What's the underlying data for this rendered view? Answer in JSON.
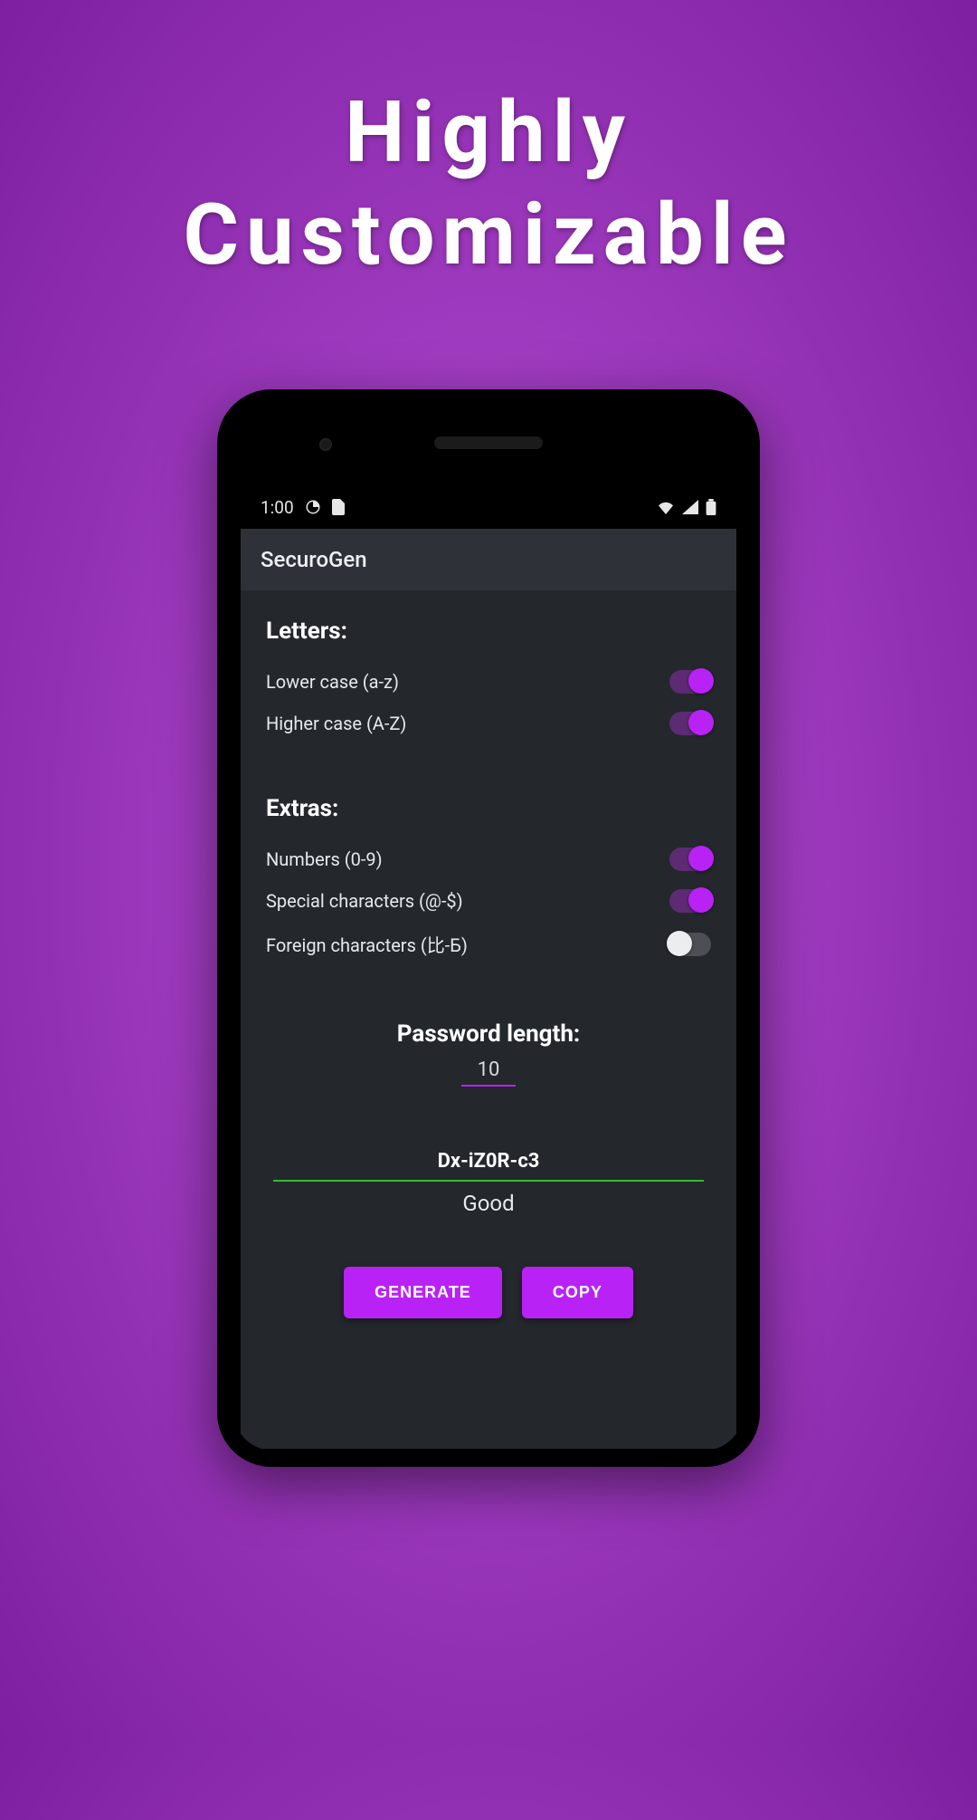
{
  "promo": {
    "line1": "Highly",
    "line2": "Customizable"
  },
  "statusbar": {
    "time": "1:00"
  },
  "appbar": {
    "title": "SecuroGen"
  },
  "sections": {
    "letters": {
      "title": "Letters:",
      "lower": {
        "label": "Lower case (a-z)",
        "on": true
      },
      "upper": {
        "label": "Higher case (A-Z)",
        "on": true
      }
    },
    "extras": {
      "title": "Extras:",
      "numbers": {
        "label": "Numbers (0-9)",
        "on": true
      },
      "special": {
        "label": "Special characters (@-$)",
        "on": true
      },
      "foreign": {
        "label": "Foreign characters (比-Б)",
        "on": false
      }
    }
  },
  "length": {
    "title": "Password length:",
    "value": "10"
  },
  "result": {
    "password": "Dx-iZ0R-c3",
    "strength": "Good"
  },
  "buttons": {
    "generate": "GENERATE",
    "copy": "COPY"
  },
  "colors": {
    "accent": "#b922f5",
    "good": "#2fbf2f"
  }
}
